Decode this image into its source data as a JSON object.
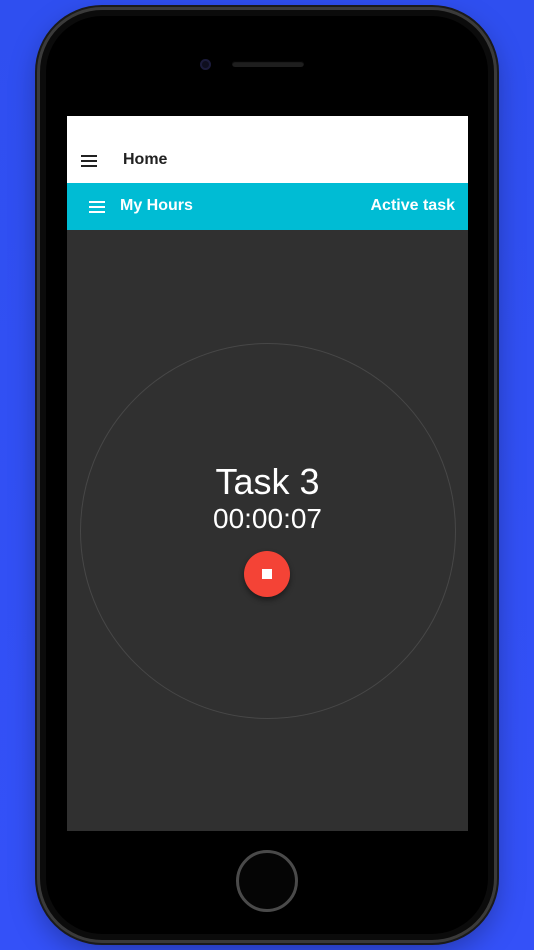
{
  "top_bar": {
    "title": "Home",
    "menu_icon": "hamburger-menu-icon"
  },
  "app_bar": {
    "title": "My Hours",
    "action": "Active task",
    "menu_icon": "hamburger-menu-icon",
    "color": "#00bcd4"
  },
  "active_task": {
    "name": "Task 3",
    "elapsed": "00:00:07",
    "stop_icon": "stop-icon",
    "stop_color": "#f44336"
  },
  "colors": {
    "background": "#3451f8",
    "screen_background": "#303030"
  }
}
